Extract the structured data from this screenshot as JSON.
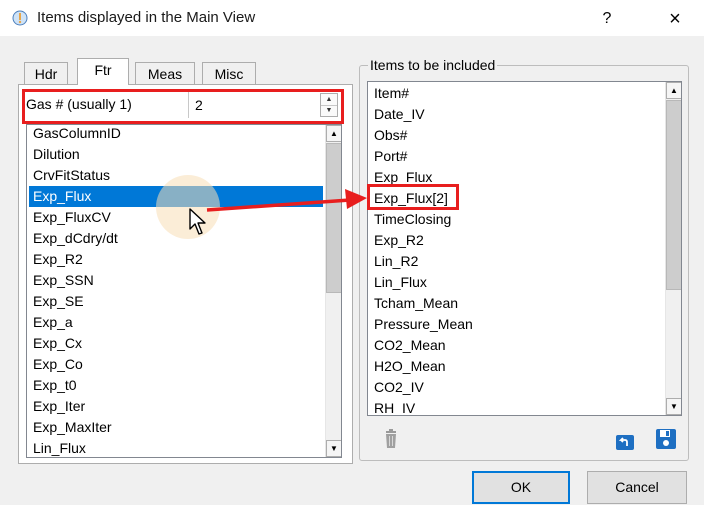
{
  "window": {
    "title": "Items displayed in the Main View",
    "help_label": "?",
    "close_label": "×"
  },
  "tabs": [
    {
      "label": "Hdr",
      "active": false
    },
    {
      "label": "Ftr",
      "active": true
    },
    {
      "label": "Meas",
      "active": false
    },
    {
      "label": "Misc",
      "active": false
    }
  ],
  "gas_field": {
    "label": "Gas # (usually 1)",
    "value": "2"
  },
  "available_items": [
    {
      "label": "GasColumnID",
      "selected": false
    },
    {
      "label": "Dilution",
      "selected": false
    },
    {
      "label": "CrvFitStatus",
      "selected": false
    },
    {
      "label": "Exp_Flux",
      "selected": true
    },
    {
      "label": "Exp_FluxCV",
      "selected": false
    },
    {
      "label": "Exp_dCdry/dt",
      "selected": false
    },
    {
      "label": "Exp_R2",
      "selected": false
    },
    {
      "label": "Exp_SSN",
      "selected": false
    },
    {
      "label": "Exp_SE",
      "selected": false
    },
    {
      "label": "Exp_a",
      "selected": false
    },
    {
      "label": "Exp_Cx",
      "selected": false
    },
    {
      "label": "Exp_Co",
      "selected": false
    },
    {
      "label": "Exp_t0",
      "selected": false
    },
    {
      "label": "Exp_Iter",
      "selected": false
    },
    {
      "label": "Exp_MaxIter",
      "selected": false
    },
    {
      "label": "Lin_Flux",
      "selected": false
    }
  ],
  "included_group": {
    "title": "Items to be included"
  },
  "included_items": [
    {
      "label": "Item#"
    },
    {
      "label": "Date_IV"
    },
    {
      "label": "Obs#"
    },
    {
      "label": "Port#"
    },
    {
      "label": "Exp_Flux"
    },
    {
      "label": "Exp_Flux[2]"
    },
    {
      "label": "TimeClosing"
    },
    {
      "label": "Exp_R2"
    },
    {
      "label": "Lin_R2"
    },
    {
      "label": "Lin_Flux"
    },
    {
      "label": "Tcham_Mean"
    },
    {
      "label": "Pressure_Mean"
    },
    {
      "label": "CO2_Mean"
    },
    {
      "label": "H2O_Mean"
    },
    {
      "label": "CO2_IV"
    },
    {
      "label": "RH_IV"
    }
  ],
  "buttons": {
    "ok": "OK",
    "cancel": "Cancel"
  },
  "icons": {
    "app": "info-icon",
    "delete": "trash-icon",
    "undo": "undo-icon",
    "save": "save-icon"
  },
  "colors": {
    "selection": "#0078d7",
    "annotation_red": "#e81e1e",
    "icon_blue": "#1e6fc2"
  }
}
